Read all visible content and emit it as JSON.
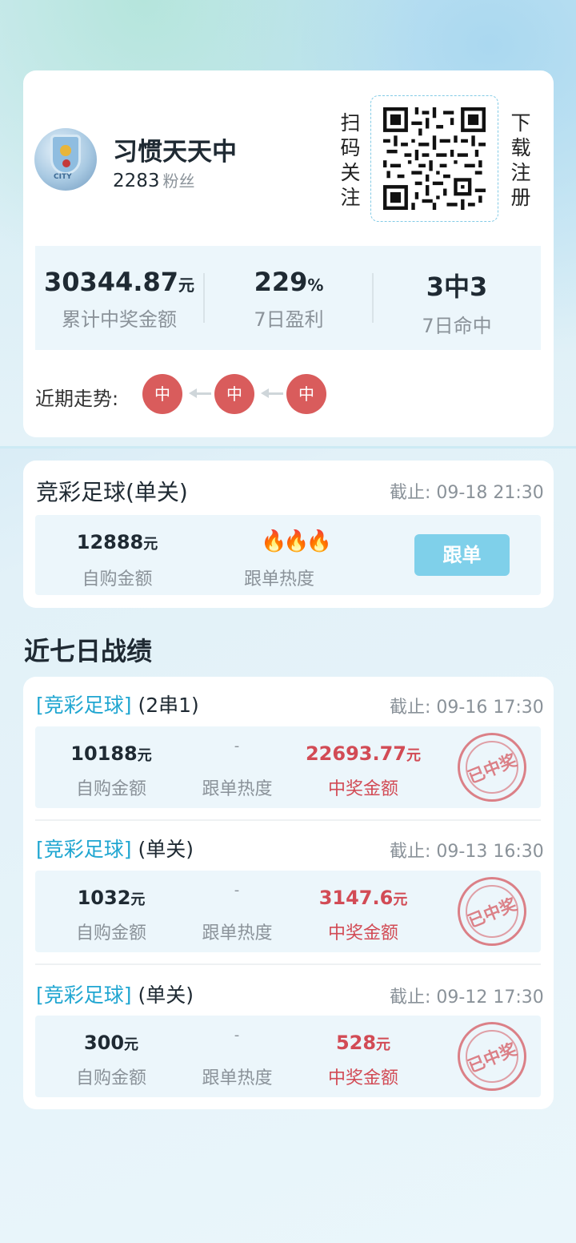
{
  "profile": {
    "name": "习惯天天中",
    "fans_count": "2283",
    "fans_label": "粉丝",
    "avatar_text": "CITY",
    "qr_left_label": [
      "扫",
      "码",
      "关",
      "注"
    ],
    "qr_right_label": [
      "下",
      "载",
      "注",
      "册"
    ],
    "stats": [
      {
        "value": "30344.87",
        "unit": "元",
        "label": "累计中奖金额"
      },
      {
        "value": "229",
        "unit": "%",
        "label": "7日盈利"
      },
      {
        "value": "3中3",
        "unit": "",
        "label": "7日命中"
      }
    ],
    "trend_label": "近期走势:",
    "trend": [
      "中",
      "中",
      "中"
    ]
  },
  "current_plan": {
    "title": "竞彩足球(单关)",
    "deadline": "截止:  09-18 21:30",
    "amount": "12888",
    "amount_unit": "元",
    "amount_label": "自购金额",
    "heat_icons": "🔥🔥🔥",
    "heat_label": "跟单热度",
    "follow_button": "跟单"
  },
  "history_title": "近七日战绩",
  "history": [
    {
      "type": "[竞彩足球]",
      "play": " (2串1)",
      "deadline": "截止:  09-16 17:30",
      "amount": "10188",
      "unit": "元",
      "amount_label": "自购金额",
      "heat": "-",
      "heat_label": "跟单热度",
      "prize": "22693.77",
      "prize_unit": "元",
      "prize_label": "中奖金额",
      "stamp": "已中奖"
    },
    {
      "type": "[竞彩足球]",
      "play": " (单关)",
      "deadline": "截止:  09-13 16:30",
      "amount": "1032",
      "unit": "元",
      "amount_label": "自购金额",
      "heat": "-",
      "heat_label": "跟单热度",
      "prize": "3147.6",
      "prize_unit": "元",
      "prize_label": "中奖金额",
      "stamp": "已中奖"
    },
    {
      "type": "[竞彩足球]",
      "play": " (单关)",
      "deadline": "截止:  09-12 17:30",
      "amount": "300",
      "unit": "元",
      "amount_label": "自购金额",
      "heat": "-",
      "heat_label": "跟单热度",
      "prize": "528",
      "prize_unit": "元",
      "prize_label": "中奖金额",
      "stamp": "已中奖"
    }
  ],
  "colors": {
    "accent": "#7fd0ea",
    "win_red": "#d24b55",
    "trend_dot": "#d95c5c",
    "bracket_blue": "#20a6d1"
  }
}
